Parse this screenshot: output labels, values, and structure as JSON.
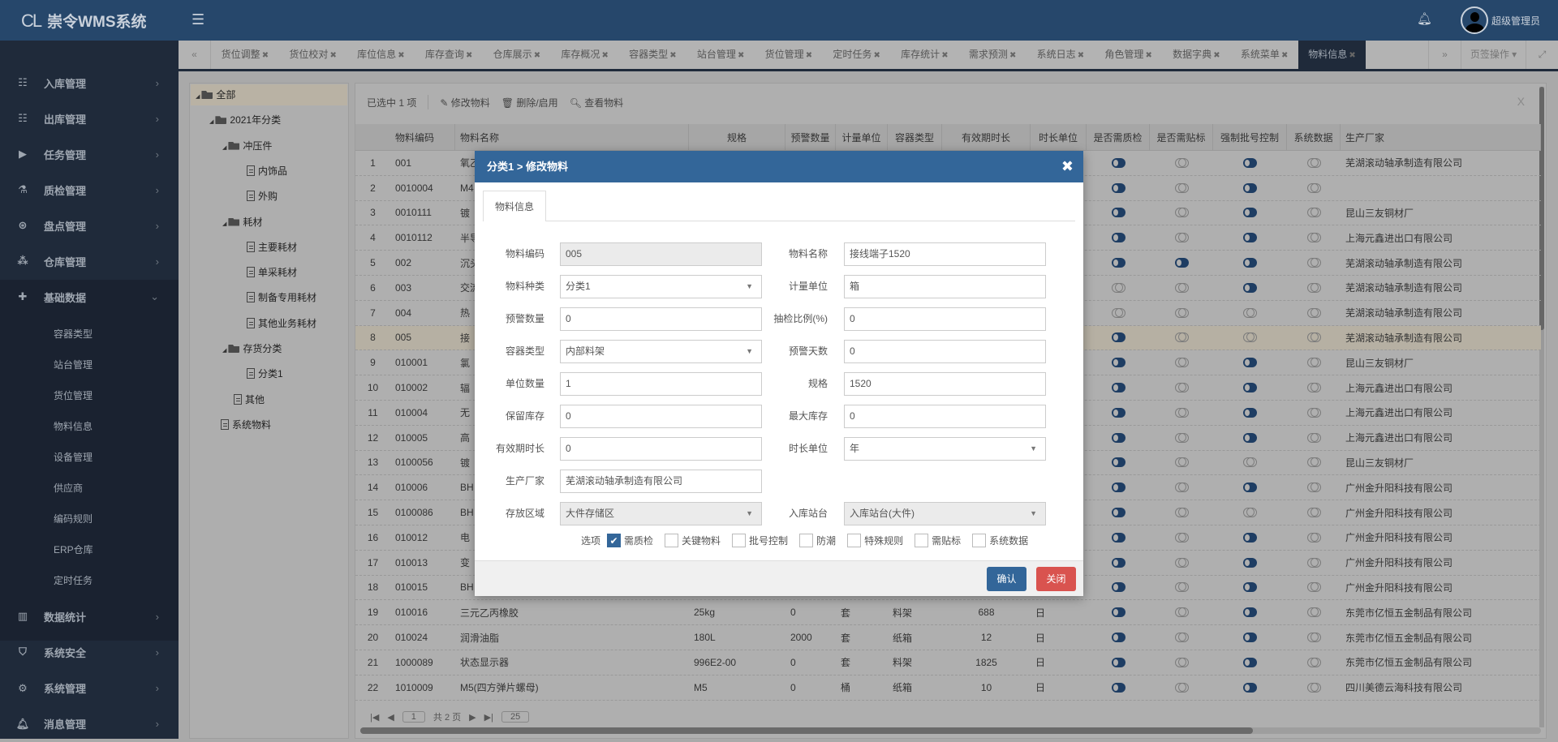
{
  "app": {
    "title": "崇令WMS系统",
    "logo_mark": "CL",
    "user": "超级管理员"
  },
  "sidebar": {
    "items": [
      {
        "label": "入库管理",
        "icon": "indent-icon"
      },
      {
        "label": "出库管理",
        "icon": "outdent-icon"
      },
      {
        "label": "任务管理",
        "icon": "play-icon"
      },
      {
        "label": "质检管理",
        "icon": "flask-icon"
      },
      {
        "label": "盘点管理",
        "icon": "life-ring-icon"
      },
      {
        "label": "仓库管理",
        "icon": "cubes-icon"
      },
      {
        "label": "基础数据",
        "icon": "puzzle-icon",
        "expanded": true
      }
    ],
    "subitems": [
      "容器类型",
      "站台管理",
      "货位管理",
      "物料信息",
      "设备管理",
      "供应商",
      "编码规则",
      "ERP仓库",
      "定时任务"
    ],
    "items_after": [
      {
        "label": "数据统计",
        "icon": "bar-chart-icon"
      },
      {
        "label": "系统安全",
        "icon": "shield-icon"
      },
      {
        "label": "系统管理",
        "icon": "cogs-icon"
      },
      {
        "label": "消息管理",
        "icon": "bell-icon"
      }
    ]
  },
  "tabs": [
    "货位调整",
    "货位校对",
    "库位信息",
    "库存查询",
    "仓库展示",
    "库存概况",
    "容器类型",
    "站台管理",
    "货位管理",
    "定时任务",
    "库存统计",
    "需求预测",
    "系统日志",
    "角色管理",
    "数据字典",
    "系统菜单",
    "物料信息"
  ],
  "active_tab": "物料信息",
  "tab_ops": "页签操作",
  "tree": [
    {
      "label": "全部",
      "type": "folder",
      "level": 0,
      "selected": true
    },
    {
      "label": "2021年分类",
      "type": "folder",
      "level": 1
    },
    {
      "label": "冲压件",
      "type": "folder",
      "level": 2
    },
    {
      "label": "内饰品",
      "type": "file",
      "level": 3
    },
    {
      "label": "外购",
      "type": "file",
      "level": 3
    },
    {
      "label": "耗材",
      "type": "folder",
      "level": 2
    },
    {
      "label": "主要耗材",
      "type": "file",
      "level": 3
    },
    {
      "label": "单采耗材",
      "type": "file",
      "level": 3
    },
    {
      "label": "制备专用耗材",
      "type": "file",
      "level": 3
    },
    {
      "label": "其他业务耗材",
      "type": "file",
      "level": 3
    },
    {
      "label": "存货分类",
      "type": "folder",
      "level": 2
    },
    {
      "label": "分类1",
      "type": "file",
      "level": 3
    },
    {
      "label": "其他",
      "type": "file",
      "level": 2
    },
    {
      "label": "系统物料",
      "type": "file",
      "level": 1
    }
  ],
  "toolbar": {
    "selected": "已选中 1 项",
    "edit": "修改物料",
    "delete": "删除/启用",
    "view": "查看物料",
    "close": "X"
  },
  "table": {
    "columns": [
      "物料编码",
      "物料名称",
      "规格",
      "预警数量",
      "计量单位",
      "容器类型",
      "有效期时长",
      "时长单位",
      "是否需质检",
      "是否需贴标",
      "强制批号控制",
      "系统数据",
      "生产厂家"
    ],
    "rows": [
      {
        "n": "1",
        "code": "001",
        "name": "氧乙",
        "qc": true,
        "label": false,
        "batch": true,
        "sys": false,
        "mfr": "芜湖滚动轴承制造有限公司"
      },
      {
        "n": "2",
        "code": "0010004",
        "name": "M4",
        "qc": true,
        "label": false,
        "batch": true,
        "sys": false,
        "mfr": ""
      },
      {
        "n": "3",
        "code": "0010111",
        "name": "镀",
        "qc": true,
        "label": false,
        "batch": true,
        "sys": false,
        "mfr": "昆山三友铜材厂"
      },
      {
        "n": "4",
        "code": "0010112",
        "name": "半导",
        "qc": true,
        "label": false,
        "batch": true,
        "sys": false,
        "mfr": "上海元鑫进出口有限公司"
      },
      {
        "n": "5",
        "code": "002",
        "name": "沉头",
        "qc": true,
        "label": true,
        "batch": true,
        "sys": false,
        "mfr": "芜湖滚动轴承制造有限公司"
      },
      {
        "n": "6",
        "code": "003",
        "name": "交流",
        "qc": false,
        "label": false,
        "batch": true,
        "sys": false,
        "mfr": "芜湖滚动轴承制造有限公司"
      },
      {
        "n": "7",
        "code": "004",
        "name": "热",
        "qc": false,
        "label": false,
        "batch": false,
        "sys": false,
        "mfr": "芜湖滚动轴承制造有限公司"
      },
      {
        "n": "8",
        "code": "005",
        "name": "接",
        "qc": true,
        "label": false,
        "batch": false,
        "sys": false,
        "mfr": "芜湖滚动轴承制造有限公司",
        "selected": true
      },
      {
        "n": "9",
        "code": "010001",
        "name": "氯",
        "qc": true,
        "label": false,
        "batch": true,
        "sys": false,
        "mfr": "昆山三友铜材厂"
      },
      {
        "n": "10",
        "code": "010002",
        "name": "辐",
        "qc": true,
        "label": false,
        "batch": true,
        "sys": false,
        "mfr": "上海元鑫进出口有限公司"
      },
      {
        "n": "11",
        "code": "010004",
        "name": "无",
        "qc": true,
        "label": false,
        "batch": true,
        "sys": false,
        "mfr": "上海元鑫进出口有限公司"
      },
      {
        "n": "12",
        "code": "010005",
        "name": "高",
        "qc": true,
        "label": false,
        "batch": true,
        "sys": false,
        "mfr": "上海元鑫进出口有限公司"
      },
      {
        "n": "13",
        "code": "0100056",
        "name": "镀",
        "qc": true,
        "label": false,
        "batch": false,
        "sys": false,
        "mfr": "昆山三友铜材厂"
      },
      {
        "n": "14",
        "code": "010006",
        "name": "BH",
        "qc": true,
        "label": false,
        "batch": true,
        "sys": false,
        "mfr": "广州金升阳科技有限公司"
      },
      {
        "n": "15",
        "code": "0100086",
        "name": "BH",
        "qc": true,
        "label": false,
        "batch": false,
        "sys": false,
        "mfr": "广州金升阳科技有限公司"
      },
      {
        "n": "16",
        "code": "010012",
        "name": "电",
        "qc": true,
        "label": false,
        "batch": true,
        "sys": false,
        "mfr": "广州金升阳科技有限公司"
      },
      {
        "n": "17",
        "code": "010013",
        "name": "变",
        "qc": true,
        "label": false,
        "batch": true,
        "sys": false,
        "mfr": "广州金升阳科技有限公司"
      },
      {
        "n": "18",
        "code": "010015",
        "name": "BH",
        "qc": true,
        "label": false,
        "batch": true,
        "sys": false,
        "mfr": "广州金升阳科技有限公司"
      },
      {
        "n": "19",
        "code": "010016",
        "name": "三元乙丙橡胶",
        "spec": "25kg",
        "warn": "0",
        "unit": "套",
        "container": "料架",
        "validity": "688",
        "vunit": "日",
        "qc": true,
        "label": false,
        "batch": true,
        "sys": false,
        "mfr": "东莞市亿恒五金制品有限公司"
      },
      {
        "n": "20",
        "code": "010024",
        "name": "润滑油脂",
        "spec": "180L",
        "warn": "2000",
        "unit": "套",
        "container": "纸箱",
        "validity": "12",
        "vunit": "日",
        "qc": true,
        "label": false,
        "batch": true,
        "sys": false,
        "mfr": "东莞市亿恒五金制品有限公司"
      },
      {
        "n": "21",
        "code": "1000089",
        "name": "状态显示器",
        "spec": "996E2-00",
        "warn": "0",
        "unit": "套",
        "container": "料架",
        "validity": "1825",
        "vunit": "日",
        "qc": true,
        "label": false,
        "batch": true,
        "sys": false,
        "mfr": "东莞市亿恒五金制品有限公司"
      },
      {
        "n": "22",
        "code": "1010009",
        "name": "M5(四方弹片螺母)",
        "spec": "M5",
        "warn": "0",
        "unit": "桶",
        "container": "纸箱",
        "validity": "10",
        "vunit": "日",
        "qc": true,
        "label": false,
        "batch": true,
        "sys": false,
        "mfr": "四川美德云海科技有限公司"
      }
    ]
  },
  "pager": {
    "page": "1",
    "total": "共 2 页",
    "size": "25"
  },
  "modal": {
    "title": "分类1 > 修改物料",
    "tab": "物料信息",
    "fields": {
      "code": {
        "label": "物料编码",
        "value": "005"
      },
      "name": {
        "label": "物料名称",
        "value": "接线端子1520"
      },
      "category": {
        "label": "物料种类",
        "value": "分类1"
      },
      "unit": {
        "label": "计量单位",
        "value": "箱"
      },
      "warn_qty": {
        "label": "预警数量",
        "value": "0"
      },
      "sample_ratio": {
        "label": "抽检比例(%)",
        "value": "0"
      },
      "container": {
        "label": "容器类型",
        "value": "内部料架"
      },
      "warn_days": {
        "label": "预警天数",
        "value": "0"
      },
      "unit_qty": {
        "label": "单位数量",
        "value": "1"
      },
      "spec": {
        "label": "规格",
        "value": "1520"
      },
      "reserve": {
        "label": "保留库存",
        "value": "0"
      },
      "max_stock": {
        "label": "最大库存",
        "value": "0"
      },
      "validity": {
        "label": "有效期时长",
        "value": "0"
      },
      "validity_unit": {
        "label": "时长单位",
        "value": "年"
      },
      "manufacturer": {
        "label": "生产厂家",
        "value": "芜湖滚动轴承制造有限公司"
      },
      "area": {
        "label": "存放区域",
        "value": "大件存储区"
      },
      "station": {
        "label": "入库站台",
        "value": "入库站台(大件)"
      }
    },
    "options_label": "选项",
    "options": [
      {
        "label": "需质检",
        "checked": true
      },
      {
        "label": "关键物料",
        "checked": false
      },
      {
        "label": "批号控制",
        "checked": false
      },
      {
        "label": "防潮",
        "checked": false
      },
      {
        "label": "特殊规则",
        "checked": false
      },
      {
        "label": "需贴标",
        "checked": false
      },
      {
        "label": "系统数据",
        "checked": false
      }
    ],
    "confirm": "确认",
    "close": "关闭"
  },
  "colors": {
    "header": "#26476b",
    "sidebar": "#1f2a3a",
    "primary": "#336699",
    "danger": "#d9534f",
    "toggle_on": "#1e3d63"
  }
}
